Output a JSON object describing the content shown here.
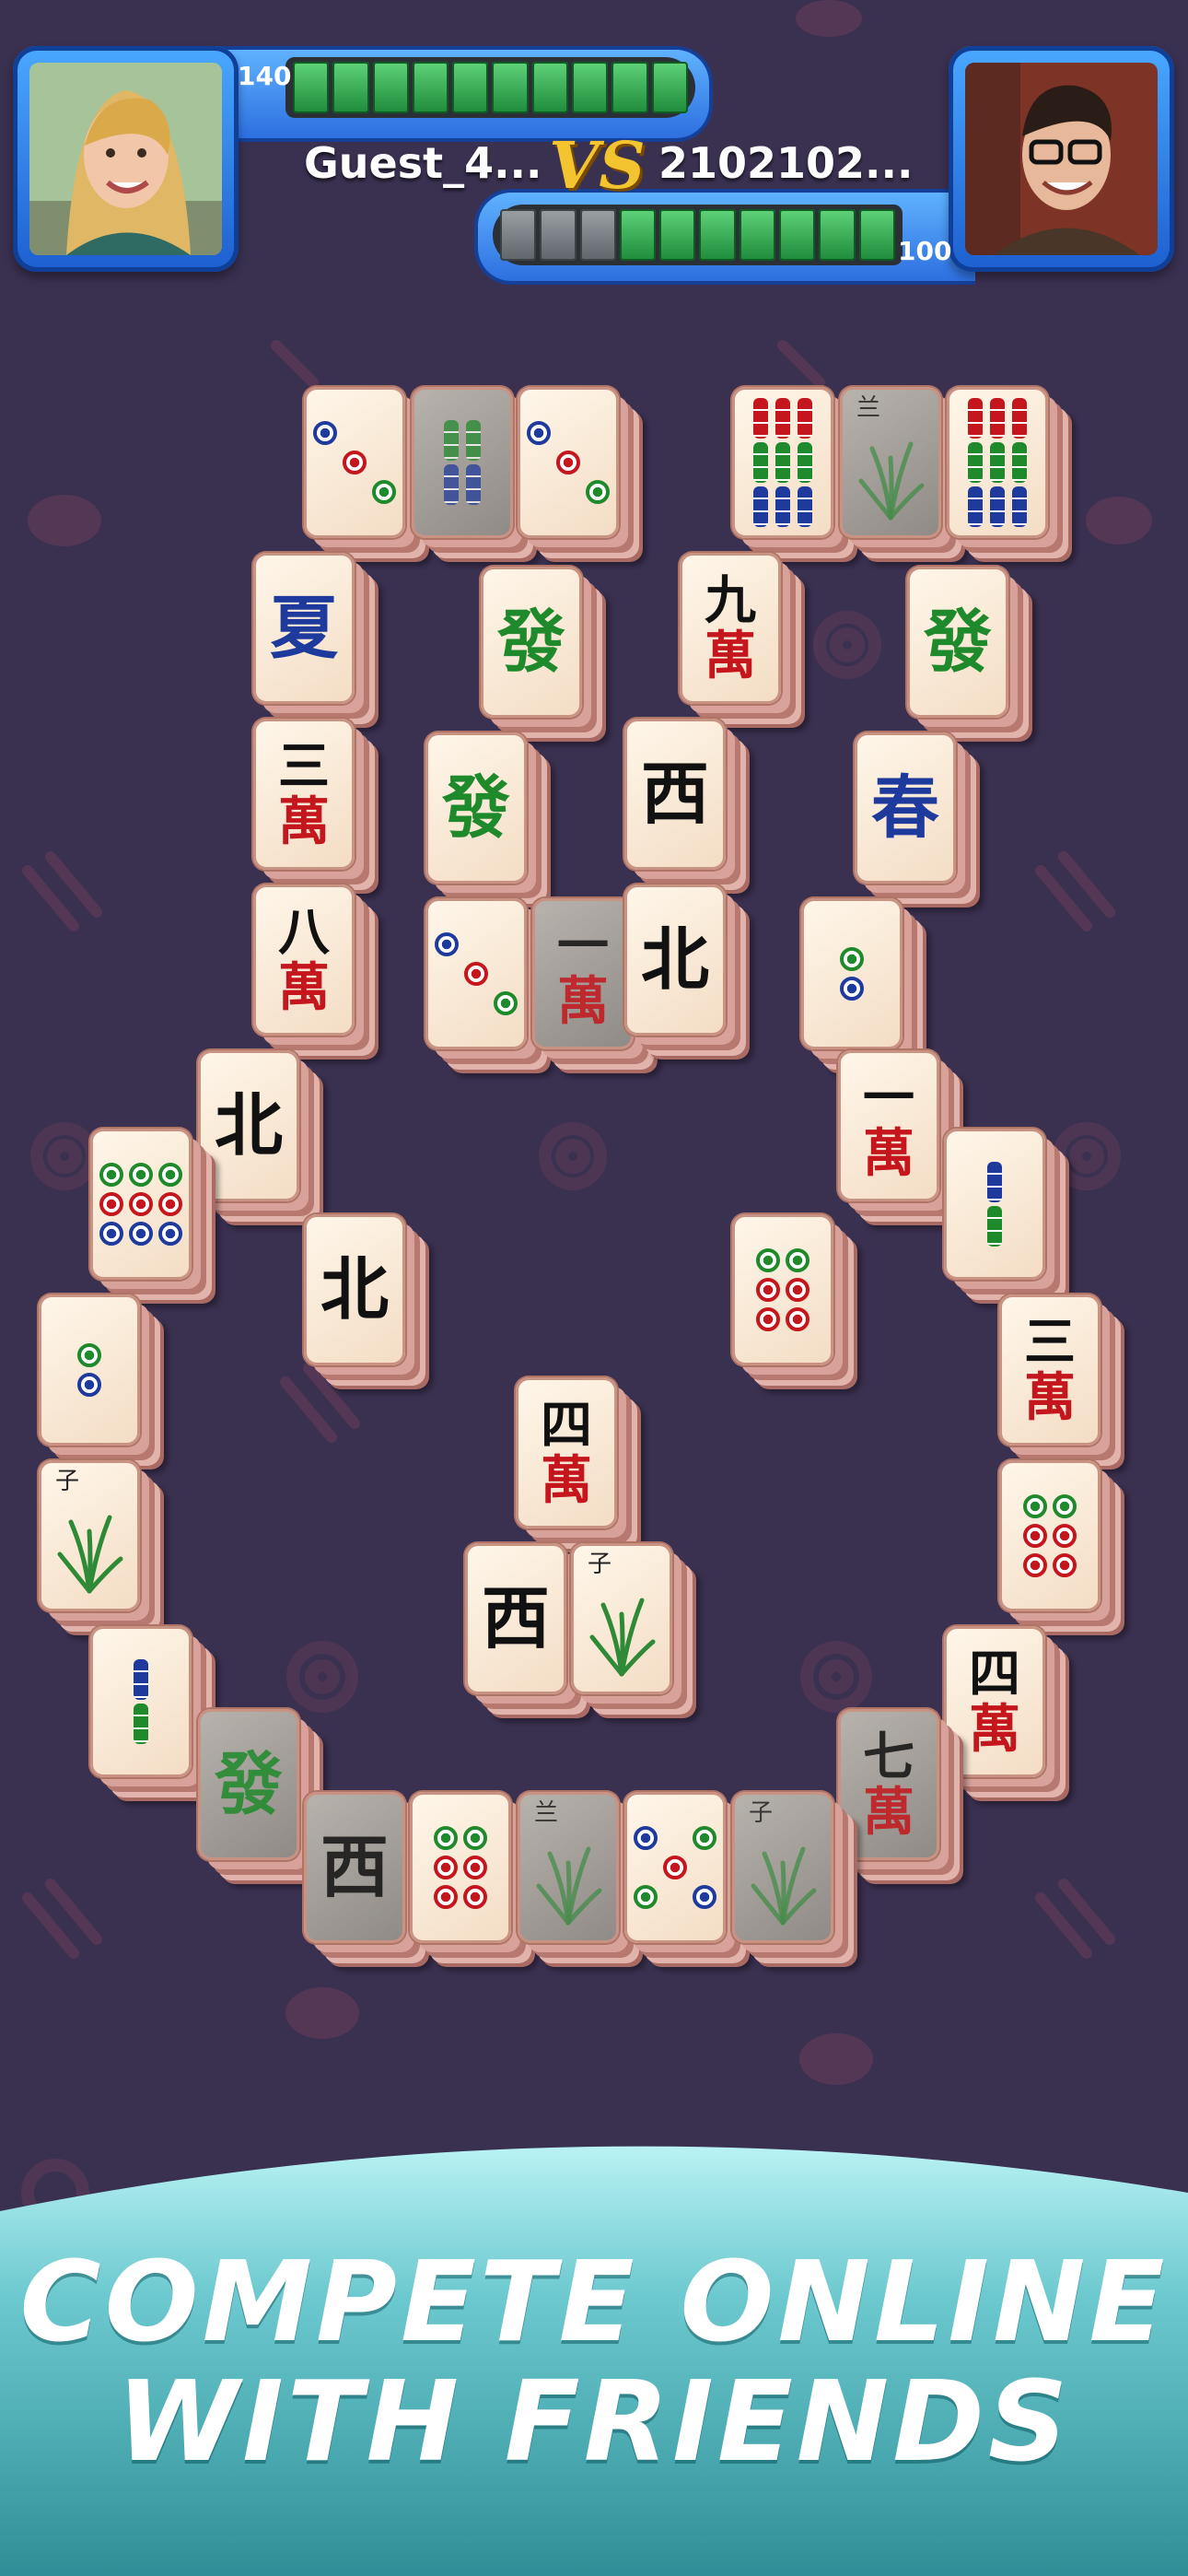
{
  "player_left": {
    "name": "Guest_4...",
    "score": "140",
    "progress_filled": 10,
    "progress_total": 10
  },
  "player_right": {
    "name": "2102102...",
    "score": "100",
    "progress_filled": 7,
    "progress_total": 10
  },
  "vs_label": "VS",
  "promo": {
    "line1": "COMPETE ONLINE",
    "line2": "WITH FRIENDS"
  },
  "colors": {
    "background": "#3a3050",
    "accent_blue": "#2d6fe0",
    "progress_green": "#3cb45a",
    "banner_teal": "#55b7bf"
  },
  "tiles": [
    {
      "kind": "dots",
      "pattern": "three"
    },
    {
      "kind": "bamboo",
      "pattern": "two-blue-green",
      "dim": true
    },
    {
      "kind": "dots",
      "pattern": "three"
    },
    {
      "kind": "bamboo",
      "pattern": "nine"
    },
    {
      "kind": "plant",
      "label": "兰",
      "dim": true
    },
    {
      "kind": "bamboo",
      "pattern": "nine"
    },
    {
      "kind": "char",
      "glyph": "夏",
      "color": "blue"
    },
    {
      "kind": "char",
      "glyph": "發",
      "color": "green"
    },
    {
      "kind": "wan",
      "num": "九",
      "wan": "萬"
    },
    {
      "kind": "char",
      "glyph": "發",
      "color": "green"
    },
    {
      "kind": "wan",
      "num": "三",
      "wan": "萬"
    },
    {
      "kind": "char",
      "glyph": "發",
      "color": "green"
    },
    {
      "kind": "char",
      "glyph": "西",
      "color": "black"
    },
    {
      "kind": "char",
      "glyph": "春",
      "color": "blue"
    },
    {
      "kind": "wan",
      "num": "八",
      "wan": "萬"
    },
    {
      "kind": "dots",
      "pattern": "three"
    },
    {
      "kind": "wan",
      "num": "一",
      "wan": "萬",
      "dim": true
    },
    {
      "kind": "char",
      "glyph": "北",
      "color": "black"
    },
    {
      "kind": "dots",
      "pattern": "two"
    },
    {
      "kind": "char",
      "glyph": "北",
      "color": "black"
    },
    {
      "kind": "wan",
      "num": "一",
      "wan": "萬"
    },
    {
      "kind": "dots",
      "pattern": "nine"
    },
    {
      "kind": "bamboo",
      "pattern": "two"
    },
    {
      "kind": "char",
      "glyph": "北",
      "color": "black"
    },
    {
      "kind": "dots",
      "pattern": "six"
    },
    {
      "kind": "dots",
      "pattern": "two"
    },
    {
      "kind": "wan",
      "num": "三",
      "wan": "萬"
    },
    {
      "kind": "wan",
      "num": "四",
      "wan": "萬"
    },
    {
      "kind": "plant",
      "label": "子"
    },
    {
      "kind": "dots",
      "pattern": "six"
    },
    {
      "kind": "char",
      "glyph": "西",
      "color": "black"
    },
    {
      "kind": "plant",
      "label": "子"
    },
    {
      "kind": "bamboo",
      "pattern": "two"
    },
    {
      "kind": "wan",
      "num": "四",
      "wan": "萬"
    },
    {
      "kind": "char",
      "glyph": "發",
      "color": "green",
      "dim": true
    },
    {
      "kind": "wan",
      "num": "七",
      "wan": "萬",
      "dim": true
    },
    {
      "kind": "char",
      "glyph": "西",
      "color": "black",
      "dim": true
    },
    {
      "kind": "dots",
      "pattern": "six"
    },
    {
      "kind": "plant",
      "label": "兰",
      "dim": true
    },
    {
      "kind": "dots",
      "pattern": "five"
    },
    {
      "kind": "plant",
      "label": "子",
      "dim": true
    }
  ]
}
